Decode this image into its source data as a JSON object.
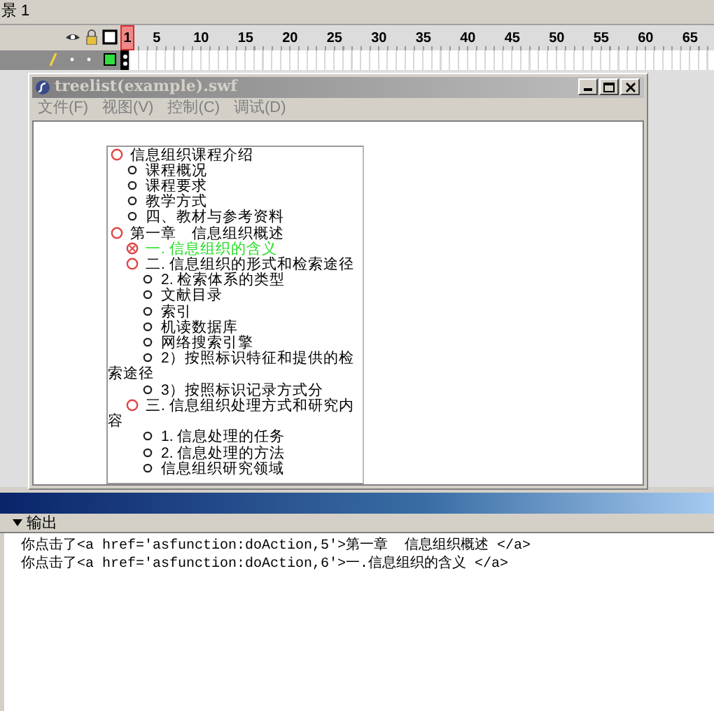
{
  "scene": "景 1",
  "timeline": {
    "frames": [
      {
        "label": "1",
        "selected": true
      },
      {
        "label": "5",
        "selected": false
      },
      {
        "label": "10",
        "selected": false
      },
      {
        "label": "15",
        "selected": false
      },
      {
        "label": "20",
        "selected": false
      },
      {
        "label": "25",
        "selected": false
      },
      {
        "label": "30",
        "selected": false
      },
      {
        "label": "35",
        "selected": false
      },
      {
        "label": "40",
        "selected": false
      },
      {
        "label": "45",
        "selected": false
      },
      {
        "label": "50",
        "selected": false
      },
      {
        "label": "55",
        "selected": false
      },
      {
        "label": "60",
        "selected": false
      },
      {
        "label": "65",
        "selected": false
      }
    ]
  },
  "swf_window": {
    "title": "treelist(example).swf",
    "menu": [
      "文件(F)",
      "视图(V)",
      "控制(C)",
      "调试(D)"
    ]
  },
  "tree": [
    {
      "label": "信息组织课程介绍",
      "kind": "branch",
      "selected": false,
      "children": [
        {
          "label": "课程概况",
          "kind": "leaf",
          "selected": false
        },
        {
          "label": "课程要求",
          "kind": "leaf",
          "selected": false
        },
        {
          "label": "教学方式",
          "kind": "leaf",
          "selected": false
        },
        {
          "label": "四、教材与参考资料",
          "kind": "leaf",
          "selected": false
        }
      ]
    },
    {
      "label": "第一章　信息组织概述",
      "kind": "branch",
      "selected": false,
      "children": [
        {
          "label": "一. 信息组织的含义",
          "kind": "branch",
          "selected": true
        },
        {
          "label": "二. 信息组织的形式和检索途径",
          "kind": "branch",
          "selected": false,
          "children": [
            {
              "label": "2. 检索体系的类型",
              "kind": "leaf",
              "selected": false
            },
            {
              "label": "文献目录",
              "kind": "leaf",
              "selected": false
            },
            {
              "label": "索引",
              "kind": "leaf",
              "selected": false
            },
            {
              "label": "机读数据库",
              "kind": "leaf",
              "selected": false
            },
            {
              "label": "网络搜索引擎",
              "kind": "leaf",
              "selected": false
            },
            {
              "label": "2）按照标识特征和提供的检索途径",
              "kind": "leaf",
              "selected": false
            },
            {
              "label": "3）按照标识记录方式分",
              "kind": "leaf",
              "selected": false
            }
          ]
        },
        {
          "label": "三. 信息组织处理方式和研究内容",
          "kind": "branch",
          "selected": false,
          "children": [
            {
              "label": "1. 信息处理的任务",
              "kind": "leaf",
              "selected": false
            },
            {
              "label": "2. 信息处理的方法",
              "kind": "leaf",
              "selected": false
            },
            {
              "label": "信息组织研究领域",
              "kind": "leaf",
              "selected": false
            }
          ]
        }
      ]
    }
  ],
  "output": {
    "title": "输出",
    "lines": [
      "你点击了<a href='asfunction:doAction,5'>第一章  信息组织概述 </a>",
      "你点击了<a href='asfunction:doAction,6'>一.信息组织的含义 </a>"
    ]
  }
}
